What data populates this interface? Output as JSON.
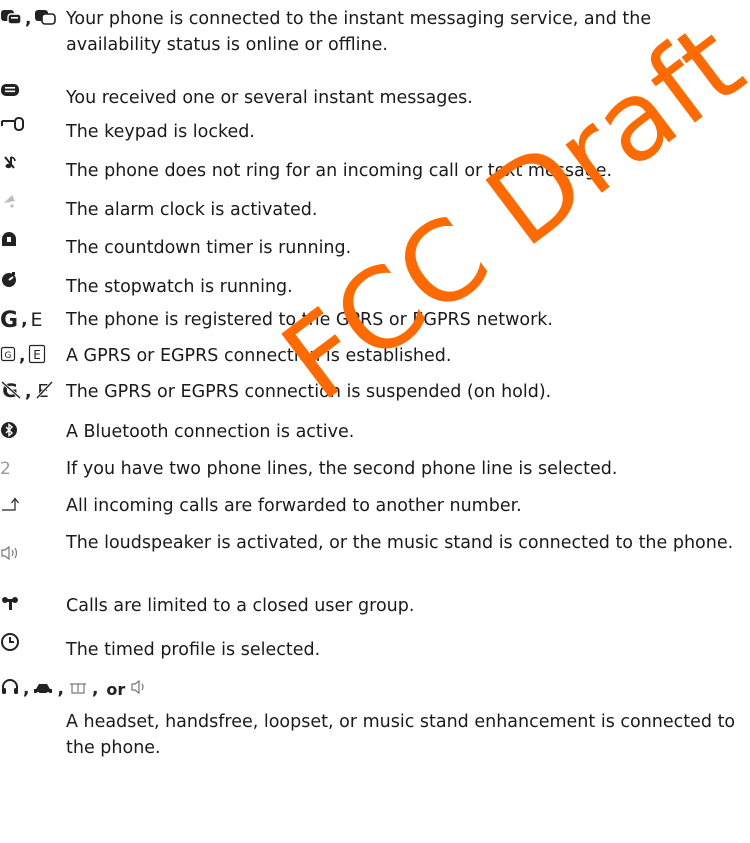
{
  "rows": [
    {
      "desc": "Your phone is connected to the instant messaging service, and the availability status is online or offline."
    },
    {
      "desc": "You received one or several instant messages."
    },
    {
      "desc": "The keypad is locked."
    },
    {
      "desc": "The phone does not ring for an incoming call or text message."
    },
    {
      "desc": "The alarm clock is activated."
    },
    {
      "desc": "The countdown timer is running."
    },
    {
      "desc": "The stopwatch is running."
    },
    {
      "desc": "The phone is registered to the GPRS or EGPRS network."
    },
    {
      "desc": "A GPRS or EGPRS connection is established."
    },
    {
      "desc": "The GPRS or EGPRS connection is suspended (on hold)."
    },
    {
      "desc": "A Bluetooth connection is active."
    },
    {
      "desc": "If you have two phone lines, the second phone line is selected."
    },
    {
      "desc": "All incoming calls are forwarded to another number."
    },
    {
      "desc": "The loudspeaker is activated, or the music stand is connected to the phone."
    },
    {
      "desc": "Calls are limited to a closed user group."
    },
    {
      "desc": "The timed profile is selected."
    },
    {
      "desc": "A headset, handsfree, loopset, or music stand enhancement is connected to the phone."
    }
  ],
  "separators": {
    "comma": ",",
    "or": "or"
  },
  "icon_glyphs": {
    "two": "2",
    "g_letter": "G",
    "e_letter": "E"
  },
  "icons": [
    "im-connected-icon",
    "im-message-icon",
    "keypad-lock-icon",
    "silent-icon",
    "alarm-icon",
    "countdown-icon",
    "stopwatch-icon",
    "gprs-icon",
    "gprs-connection-icon",
    "gprs-suspended-icon",
    "bluetooth-icon",
    "second-line-icon",
    "call-forward-icon",
    "loudspeaker-icon",
    "closed-user-group-icon",
    "timed-profile-icon",
    "headset-icon"
  ],
  "watermark": "FCC Draft",
  "colors": {
    "watermark": "#ff6a00",
    "text": "#1a1a1a"
  }
}
